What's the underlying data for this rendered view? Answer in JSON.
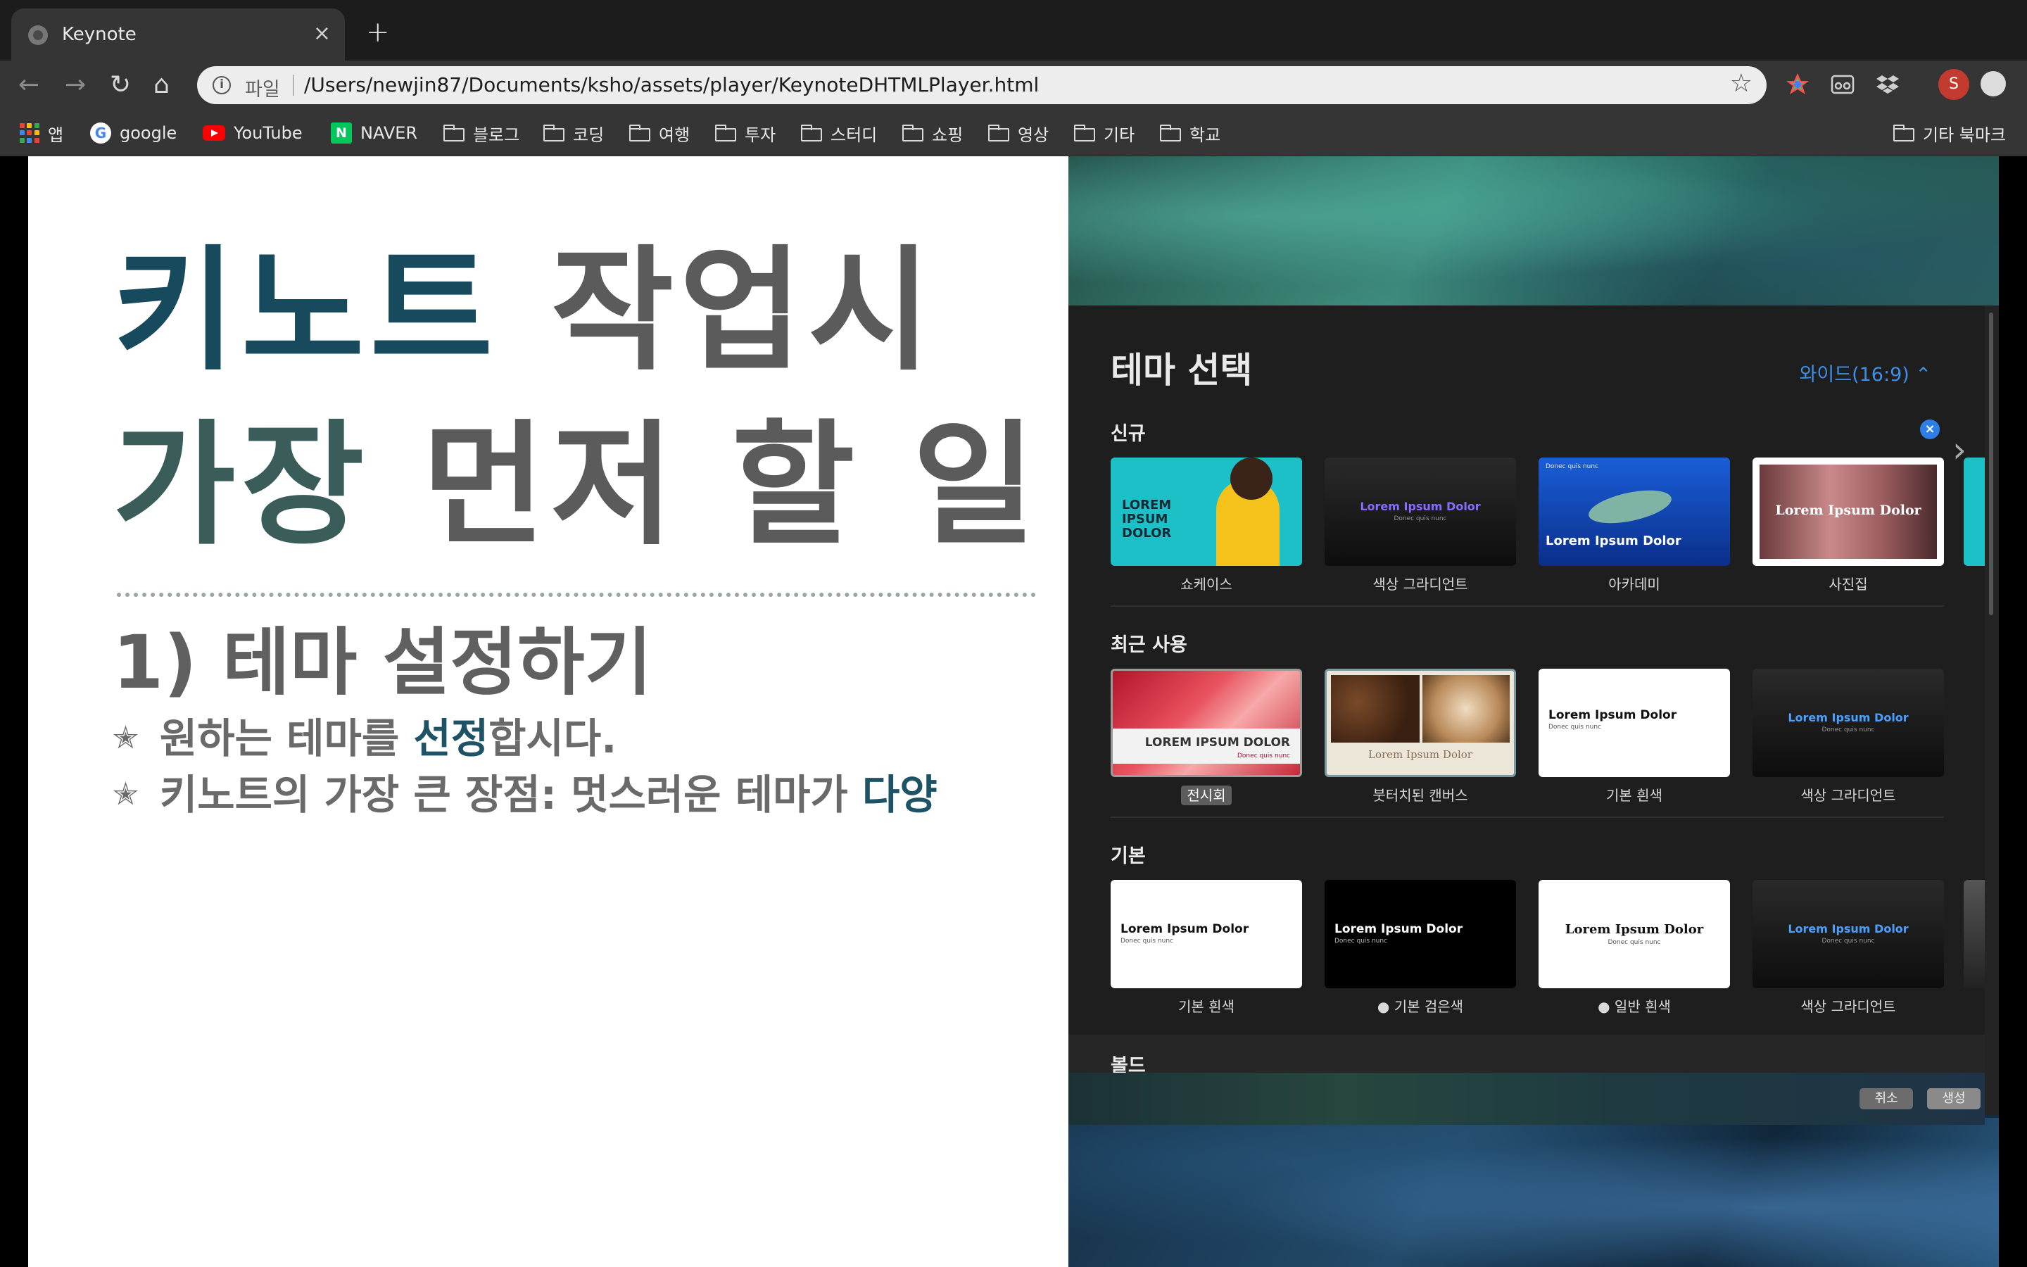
{
  "browser": {
    "tab_title": "Keynote",
    "tab_close": "×",
    "new_tab": "+",
    "scheme_label": "파일",
    "url": "/Users/newjin87/Documents/ksho/assets/player/KeynoteDHTMLPlayer.html",
    "profile_initial": "S",
    "nav": {
      "back": "←",
      "forward": "→",
      "reload": "↻",
      "home": "⌂",
      "star": "☆"
    }
  },
  "bookmarks": {
    "apps": "앱",
    "google": "google",
    "youtube": "YouTube",
    "naver": "NAVER",
    "folders": [
      "블로그",
      "코딩",
      "여행",
      "투자",
      "스터디",
      "쇼핑",
      "영상",
      "기타",
      "학교"
    ],
    "other": "기타 북마크"
  },
  "slide": {
    "title_line1_part1": "키노트",
    "title_line1_part2": " 작업시",
    "title_line2_part1": "가장",
    "title_line2_part2": " 먼저 할 일",
    "subtitle": "1) 테마 설정하기",
    "bullet1": {
      "star": "✭",
      "pre": "원하는 테마를 ",
      "highlight": "선정",
      "post": "합시다."
    },
    "bullet2": {
      "star": "✭",
      "pre": "키노트의 가장 큰 장점: 멋스러운 테마가 ",
      "highlight": "다양"
    }
  },
  "colors": {
    "title_dark": "#174a5c",
    "title_gray": "#5b5b5b",
    "title_teal": "#3a5d5a",
    "accent_blue": "#3d8fe8"
  },
  "theme_dialog": {
    "title": "테마 선택",
    "ratio": "와이드(16:9) ⌃",
    "close_icon": "×",
    "next_arrow": "›",
    "sections": {
      "new": "신규",
      "recent": "최근 사용",
      "basic": "기본",
      "bold": "볼드"
    },
    "new_themes": [
      {
        "label": "쇼케이스",
        "title": "LOREM IPSUM DOLOR",
        "sub": ""
      },
      {
        "label": "색상 그라디언트",
        "title": "Lorem Ipsum Dolor",
        "sub": "Donec quis nunc"
      },
      {
        "label": "아카데미",
        "title": "Lorem Ipsum Dolor",
        "sub": "Donec quis nunc"
      },
      {
        "label": "사진집",
        "title": "Lorem Ipsum Dolor",
        "sub": ""
      }
    ],
    "recent_themes": [
      {
        "label": "전시회",
        "title": "LOREM IPSUM DOLOR",
        "sub": "Donec quis nunc"
      },
      {
        "label": "붓터치된 캔버스",
        "title": "Lorem Ipsum Dolor",
        "sub": ""
      },
      {
        "label": "기본 흰색",
        "title": "Lorem Ipsum Dolor",
        "sub": "Donec quis nunc"
      },
      {
        "label": "색상 그라디언트",
        "title": "Lorem Ipsum Dolor",
        "sub": "Donec quis nunc"
      }
    ],
    "basic_themes": [
      {
        "label": "기본 흰색",
        "title": "Lorem Ipsum Dolor",
        "sub": "Donec quis nunc"
      },
      {
        "label": "● 기본 검은색",
        "title": "Lorem Ipsum Dolor",
        "sub": "Donec quis nunc"
      },
      {
        "label": "● 일반 흰색",
        "title": "Lorem Ipsum Dolor",
        "sub": "Donec quis nunc"
      },
      {
        "label": "색상 그라디언트",
        "title": "Lorem Ipsum Dolor",
        "sub": "Donec quis nunc"
      }
    ],
    "buttons": {
      "cancel": "취소",
      "create": "생성"
    }
  }
}
